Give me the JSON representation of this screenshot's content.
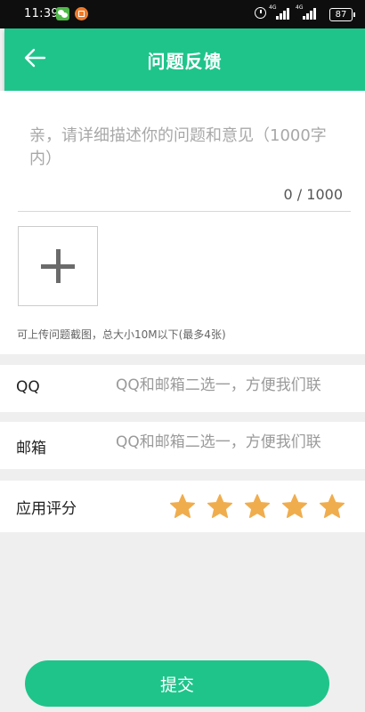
{
  "status_bar": {
    "time": "11:39",
    "network_1": "4G",
    "network_2": "4G",
    "battery": "87"
  },
  "header": {
    "title": "问题反馈",
    "back_icon": "arrow-left-icon"
  },
  "feedback": {
    "placeholder": "亲，请详细描述你的问题和意见（1000字内）",
    "counter": "0 / 1000",
    "upload_icon": "plus-icon",
    "upload_hint": "可上传问题截图，总大小10M以下(最多4张)"
  },
  "contact": {
    "qq_label": "QQ",
    "qq_placeholder": "QQ和邮箱二选一，方便我们联",
    "email_label": "邮箱",
    "email_placeholder": "QQ和邮箱二选一，方便我们联"
  },
  "rating": {
    "label": "应用评分",
    "value": 5,
    "max": 5,
    "star_color": "#f0ad4e"
  },
  "submit_label": "提交",
  "colors": {
    "accent": "#1fc48b"
  }
}
